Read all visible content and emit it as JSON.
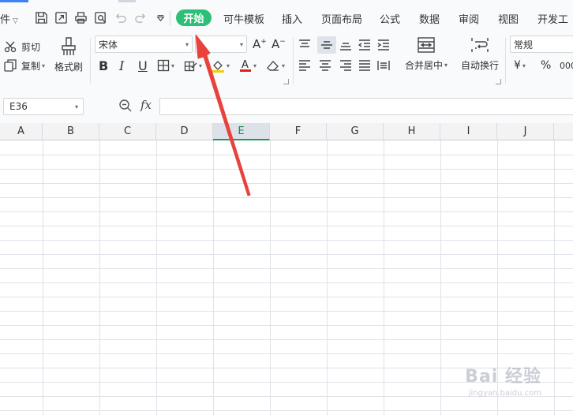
{
  "menu": {
    "file_label": "件",
    "tabs": [
      {
        "label": "开始",
        "active": true
      },
      {
        "label": "可牛模板"
      },
      {
        "label": "插入"
      },
      {
        "label": "页面布局"
      },
      {
        "label": "公式"
      },
      {
        "label": "数据"
      },
      {
        "label": "审阅"
      },
      {
        "label": "视图"
      },
      {
        "label": "开发工"
      }
    ],
    "active_color": "#2dbe78"
  },
  "ribbon": {
    "cut_label": "剪切",
    "copy_label": "复制",
    "format_painter_label": "格式刷",
    "font_name": "宋体",
    "font_size": "",
    "merge_center_label": "合并居中",
    "wrap_text_label": "自动换行",
    "number_format": "常规",
    "currency_symbol": "¥",
    "percent_symbol": "%",
    "font_color_accent": "#e02020",
    "fill_color_accent": "#f5d000"
  },
  "formula_bar": {
    "name_box": "E36",
    "fx_label": "fx",
    "formula": ""
  },
  "sheet": {
    "columns": [
      "A",
      "B",
      "C",
      "D",
      "E",
      "F",
      "G",
      "H",
      "I",
      "J"
    ],
    "selected_column": "E",
    "selection_color": "#1f9d55"
  },
  "annotation": {
    "arrow_color": "#e8423c"
  },
  "watermark": {
    "main": "Bai 经验",
    "sub": "jingyan.baidu.com"
  }
}
